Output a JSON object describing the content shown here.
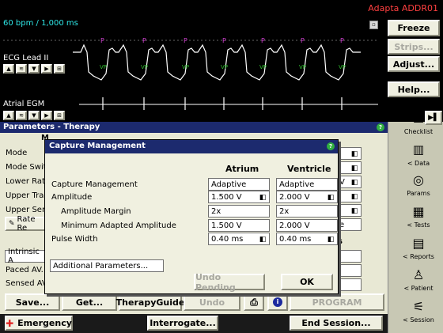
{
  "topbar": {
    "app_label": "Adapta ADDR01"
  },
  "ecg": {
    "speed": "60 bpm / 1,000 ms",
    "lead_label": "ECG Lead II",
    "atrial_label": "Atrial EGM",
    "marker_top": "P",
    "marker_bottom": "VP"
  },
  "right_panel": {
    "freeze": "Freeze",
    "strips": "Strips...",
    "adjust": "Adjust...",
    "help": "Help..."
  },
  "sidebar": {
    "items": [
      {
        "label": "Checklist"
      },
      {
        "label": "< Data"
      },
      {
        "label": "Params"
      },
      {
        "label": "< Tests"
      },
      {
        "label": "< Reports"
      },
      {
        "label": "< Patient"
      },
      {
        "label": "< Session"
      }
    ]
  },
  "params": {
    "title": "Parameters - Therapy",
    "header_fragment": "M",
    "rows": [
      {
        "label": "Mode"
      },
      {
        "label": "Mode Switc"
      },
      {
        "label": "Lower Rate"
      },
      {
        "label": "Upper Track"
      },
      {
        "label": "Upper Sens"
      }
    ],
    "rate_resp": "Rate Re",
    "intrinsic": "Intrinsic A",
    "paced_av": "Paced AV...",
    "sensed_av": "Sensed AV",
    "right_fragment_e": "e",
    "right_fragment_s": "s",
    "right_fragment_v": "V"
  },
  "dialog": {
    "title": "Capture Management",
    "col_atrium": "Atrium",
    "col_ventricle": "Ventricle",
    "rows": [
      {
        "label": "Capture Management",
        "atrium": "Adaptive",
        "ventricle": "Adaptive"
      },
      {
        "label": "Amplitude",
        "atrium": "1.500 V",
        "ventricle": "2.000 V"
      },
      {
        "label": "Amplitude Margin",
        "atrium": "2x",
        "ventricle": "2x"
      },
      {
        "label": "Minimum Adapted Amplitude",
        "atrium": "1.500 V",
        "ventricle": "2.000 V"
      },
      {
        "label": "Pulse Width",
        "atrium": "0.40 ms",
        "ventricle": "0.40 ms"
      }
    ],
    "additional": "Additional Parameters...",
    "undo_pending": "Undo Pending",
    "ok": "OK"
  },
  "bottom": {
    "save": "Save...",
    "get": "Get...",
    "therapy_guide": "TherapyGuide",
    "undo": "Undo",
    "program": "PROGRAM",
    "emergency": "Emergency",
    "interrogate": "Interrogate...",
    "end_session": "End Session..."
  }
}
